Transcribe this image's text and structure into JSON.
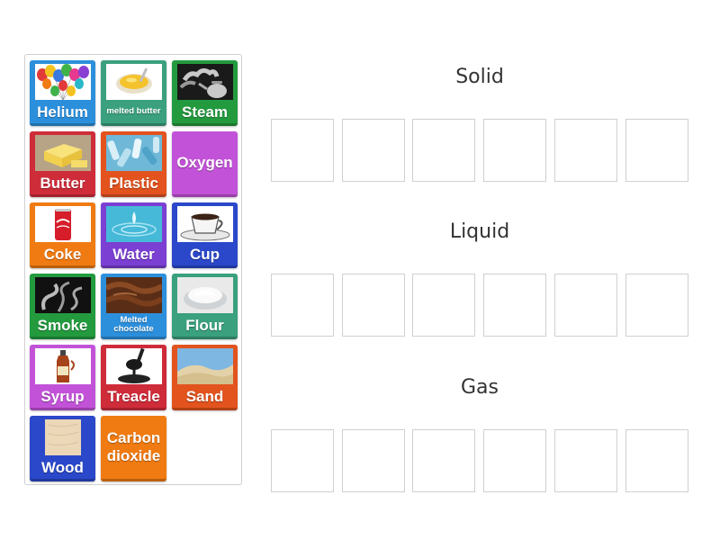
{
  "tiles": [
    {
      "label": "Helium",
      "icon": "balloons-icon",
      "color": "#2c8fdc"
    },
    {
      "label": "melted butter",
      "icon": "melted-butter-icon",
      "color": "#3aa07e"
    },
    {
      "label": "Steam",
      "icon": "kettle-steam-icon",
      "color": "#239a3e"
    },
    {
      "label": "Butter",
      "icon": "butter-icon",
      "color": "#cf2c3a"
    },
    {
      "label": "Plastic",
      "icon": "plastic-bottles-icon",
      "color": "#e2531e"
    },
    {
      "label": "Oxygen",
      "icon": "",
      "color": "#c253d8"
    },
    {
      "label": "Coke",
      "icon": "coke-can-icon",
      "color": "#f07b12"
    },
    {
      "label": "Water",
      "icon": "water-drop-icon",
      "color": "#7b3fd3"
    },
    {
      "label": "Cup",
      "icon": "coffee-cup-icon",
      "color": "#2a48c9"
    },
    {
      "label": "Smoke",
      "icon": "smoke-icon",
      "color": "#239a3e"
    },
    {
      "label": "Melted chocolate",
      "icon": "melted-chocolate-icon",
      "color": "#2c8fdc"
    },
    {
      "label": "Flour",
      "icon": "flour-bowl-icon",
      "color": "#3aa07e"
    },
    {
      "label": "Syrup",
      "icon": "syrup-bottle-icon",
      "color": "#c253d8"
    },
    {
      "label": "Treacle",
      "icon": "treacle-spoon-icon",
      "color": "#cf2c3a"
    },
    {
      "label": "Sand",
      "icon": "sand-dunes-icon",
      "color": "#e2531e"
    },
    {
      "label": "Wood",
      "icon": "wood-texture-icon",
      "color": "#2a48c9"
    },
    {
      "label": "Carbon dioxide",
      "icon": "",
      "color": "#f07b12"
    }
  ],
  "groups": [
    {
      "heading": "Solid"
    },
    {
      "heading": "Liquid"
    },
    {
      "heading": "Gas"
    }
  ]
}
